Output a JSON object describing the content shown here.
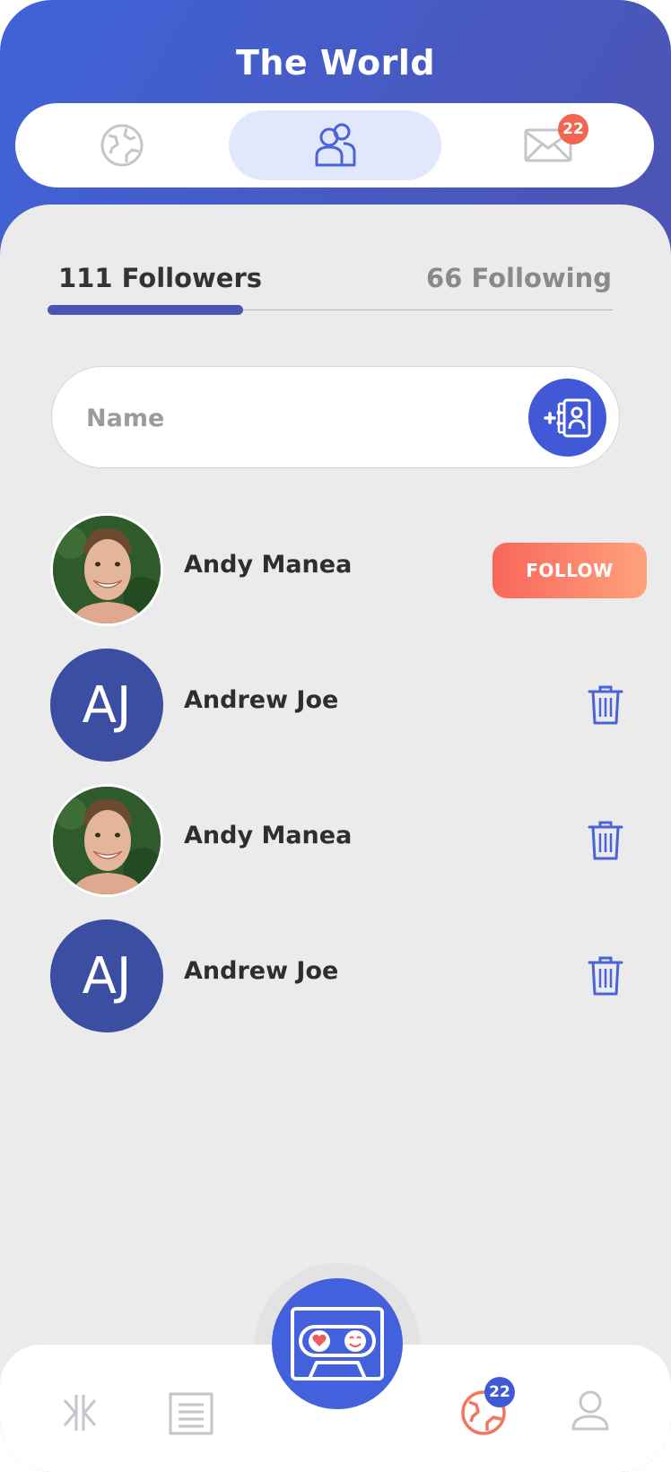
{
  "header": {
    "title": "The World"
  },
  "top_tabs": [
    {
      "name": "world",
      "icon": "globe-icon"
    },
    {
      "name": "people",
      "icon": "people-icon",
      "active": true
    },
    {
      "name": "messages",
      "icon": "envelope-icon",
      "badge": "22"
    }
  ],
  "segments": {
    "followers_label": "111 Followers",
    "following_label": "66 Following",
    "active": "followers"
  },
  "search": {
    "placeholder": "Name",
    "value": "",
    "button_icon": "add-contact-icon"
  },
  "people": [
    {
      "name": "Andy Manea",
      "avatar": "photo",
      "action": "FOLLOW"
    },
    {
      "name": "Andrew Joe",
      "avatar": "initials",
      "initials": "AJ",
      "action": "delete"
    },
    {
      "name": "Andy Manea",
      "avatar": "photo",
      "action": "delete"
    },
    {
      "name": "Andrew Joe",
      "avatar": "initials",
      "initials": "AJ",
      "action": "delete"
    }
  ],
  "bottom_nav": {
    "items": [
      {
        "name": "connect",
        "icon": "split-arrows-icon"
      },
      {
        "name": "feed",
        "icon": "document-icon"
      },
      {
        "name": "center",
        "icon": "cassette-icon"
      },
      {
        "name": "world",
        "icon": "globe-icon",
        "badge": "22",
        "active": true
      },
      {
        "name": "profile",
        "icon": "user-icon"
      }
    ]
  },
  "colors": {
    "accent": "#4159d6",
    "header_gradient_start": "#3f63d9",
    "header_gradient_end": "#5a4c9c",
    "follow_start": "#f9665a",
    "follow_end": "#fda27d",
    "badge": "#f2664f",
    "initials_bg": "#3c4ea1"
  }
}
